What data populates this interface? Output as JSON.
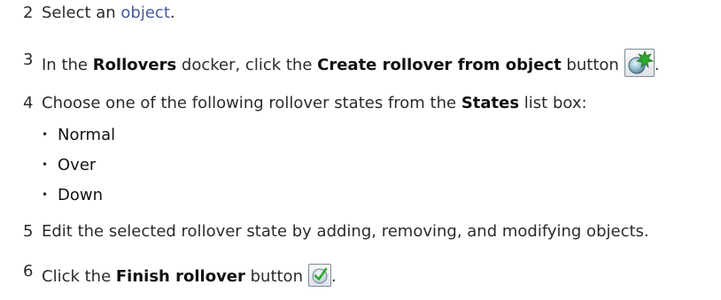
{
  "steps": [
    {
      "number": "2",
      "text_before": "Select an ",
      "link": "object",
      "text_after": "."
    },
    {
      "number": "3",
      "text_1": "In the ",
      "ui_1": "Rollovers",
      "text_2": " docker, click the ",
      "ui_2": "Create rollover from object",
      "text_3": " button",
      "text_end": ".",
      "icon": "create-rollover-icon"
    },
    {
      "number": "4",
      "text_1": "Choose one of the following rollover states from the ",
      "ui_1": "States",
      "text_2": " list box:",
      "bullets": [
        "Normal",
        "Over",
        "Down"
      ]
    },
    {
      "number": "5",
      "text": "Edit the selected rollover state by adding, removing, and modifying objects."
    },
    {
      "number": "6",
      "text_1": "Click the ",
      "ui_1": "Finish rollover",
      "text_2": " button",
      "text_end": ".",
      "icon": "finish-rollover-icon"
    }
  ],
  "bullet_glyph": "•",
  "colors": {
    "text": "#2b2b2b",
    "link": "#4a5a9a",
    "icon_green": "#2ea82e"
  }
}
